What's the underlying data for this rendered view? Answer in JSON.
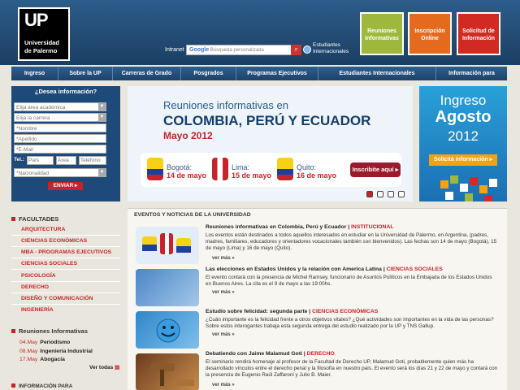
{
  "header": {
    "logo_up": "UP",
    "logo_line1": "Universidad",
    "logo_line2": "de Palermo",
    "intranet": "Intranet",
    "search_google": "Google",
    "search_placeholder": "Búsqueda personalizada",
    "intl_line1": "Estudiantes",
    "intl_line2": "Internacionales",
    "box1": "Reuniones Informativas",
    "box2": "Inscripción Online",
    "box3": "Solicitud de Información",
    "box_colors": [
      "#9cb93e",
      "#e46a1e",
      "#d02a22"
    ]
  },
  "nav": [
    "Ingreso",
    "Sobre la UP",
    "Carreras de Grado",
    "Posgrados",
    "Programas Ejecutivos",
    "Estudiantes Internacionales",
    "Información para"
  ],
  "form": {
    "title": "¿Desea información?",
    "area": "Elija área académica",
    "carrera": "Elija la carrera",
    "nombre": "*Nombre",
    "apellido": "*Apellido",
    "email": "*E-Mail",
    "tel_label": "Tel.:",
    "pais": "País",
    "area_code": "Área",
    "telefono": "Teléfono",
    "nacionalidad": "*Nacionalidad",
    "enviar": "ENVIAR ▸"
  },
  "banner": {
    "line1": "Reuniones informativas en",
    "line2": "COLOMBIA, PERÚ Y ECUADOR",
    "line3": "Mayo 2012",
    "cities": [
      {
        "city": "Bogotá:",
        "date": "14 de mayo"
      },
      {
        "city": "Lima:",
        "date": "15 de mayo"
      },
      {
        "city": "Quito:",
        "date": "16 de mayo"
      }
    ],
    "button": "Inscribite aquí ▸"
  },
  "ad": {
    "line1": "Ingreso",
    "line2": "Agosto",
    "line3": "2012",
    "button": "Solicitá información ▸"
  },
  "sidebar": {
    "facultades_title": "FACULTADES",
    "facultades": [
      "ARQUITECTURA",
      "CIENCIAS ECONÓMICAS",
      "MBA - PROGRAMAS EJECUTIVOS",
      "CIENCIAS SOCIALES",
      "PSICOLOGÍA",
      "DERECHO",
      "DISEÑO Y COMUNICACIÓN",
      "INGENIERÍA"
    ],
    "reuniones_title": "Reuniones Informativas",
    "reuniones": [
      {
        "date": "04.May",
        "name": "Periodismo"
      },
      {
        "date": "08.May",
        "name": "Ingeniería Industrial"
      },
      {
        "date": "17.May",
        "name": "Abogacía"
      }
    ],
    "ver_todo": "Ver todas",
    "info_title": "INFORMACIÓN PARA"
  },
  "news": {
    "title": "EVENTOS Y NOTICIAS DE LA UNIVERSIDAD",
    "ver_mas": "ver más »",
    "articles": [
      {
        "title": "Reuniones informativas en Colombia, Perú y Ecuador |",
        "category": "INSTITUCIONAL",
        "body": "Los eventos están destinados a todos aquellos interesados en estudiar en la Universidad de Palermo, en Argentina, (padres, madres, familiares, educadores y orientadores vocacionales también son bienvenidos). Las fechas son 14 de mayo (Bogotá), 15 de mayo (Lima) y 16 de mayo (Quito)."
      },
      {
        "title": "Las elecciones en Estados Unidos y la relación con America Latina |",
        "category": "CIENCIAS SOCIALES",
        "body": "El evento contará con la presencia de Michel Ramsey, funcionario de Asuntos Políticos en la Embajada de los Estados Unidos en Buenos Aires. La cita es el 9 de mayo a las 19:00hs."
      },
      {
        "title": "Estudio sobre felicidad: segunda parte |",
        "category": "CIENCIAS ECONÓMICAS",
        "body": "¿Cuán importante es la felicidad frente a otros objetivos vitales? ¿Qué actividades son importantes en la vida de las personas? Sobre estos interogantes trabaja esta segunda entrega del estudio realizado por la UP y TNS Gallup."
      },
      {
        "title": "Debatiendo con Jaime Malamud Goti |",
        "category": "DERECHO",
        "body": "El seminario rendirá homenaje al profesor de la Facultad de Derecho UP, Malamud Goti, probablemente quien más ha desarrollado vínculos entre el derecho penal y la filosofía en nuestro país. El evento será los días 21 y 22 de mayo y contará con la presencia de Eugenio Raúl Zaffaroni y Julio B. Maier."
      }
    ]
  }
}
